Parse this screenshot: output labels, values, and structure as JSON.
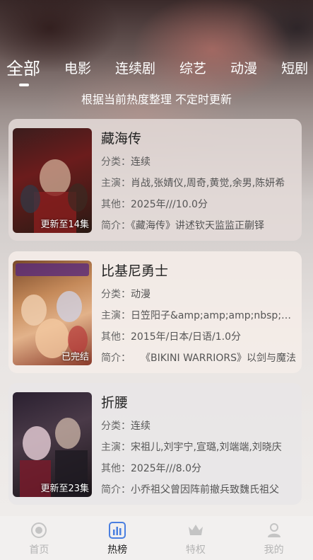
{
  "tabs": [
    "全部",
    "电影",
    "连续剧",
    "综艺",
    "动漫",
    "短剧"
  ],
  "subtitle": "根据当前热度整理 不定时更新",
  "labels": {
    "category": "分类：",
    "cast": "主演：",
    "other": "其他：",
    "intro": "简介："
  },
  "items": [
    {
      "title": "藏海传",
      "badge": "更新至14集",
      "category": "连续",
      "cast": "肖战,张婧仪,周奇,黄觉,余男,陈妍希",
      "other": "2025年///10.0分",
      "intro": "《藏海传》讲述钦天监监正蒯铎"
    },
    {
      "title": "比基尼勇士",
      "badge": "已完结",
      "category": "动漫",
      "cast": "日笠阳子&amp;amp;amp;nbsp;植田佳奈",
      "other": "2015年/日本/日语/1.0分",
      "intro": "　　《BIKINI WARRIORS》以剑与魔法"
    },
    {
      "title": "折腰",
      "badge": "更新至23集",
      "category": "连续",
      "cast": "宋祖儿,刘宇宁,宣璐,刘端端,刘晓庆",
      "other": "2025年///8.0分",
      "intro": "小乔祖父曾因阵前撤兵致魏氏祖父"
    }
  ],
  "nav": [
    {
      "label": "首页",
      "icon": "home-icon"
    },
    {
      "label": "热榜",
      "icon": "chart-icon",
      "active": true
    },
    {
      "label": "特权",
      "icon": "vip-crown-icon"
    },
    {
      "label": "我的",
      "icon": "profile-icon"
    }
  ],
  "colors": {
    "nav_active": "#222222",
    "nav_inactive": "#b4b4b4",
    "chart_icon_blue": "#4a7fe0"
  }
}
